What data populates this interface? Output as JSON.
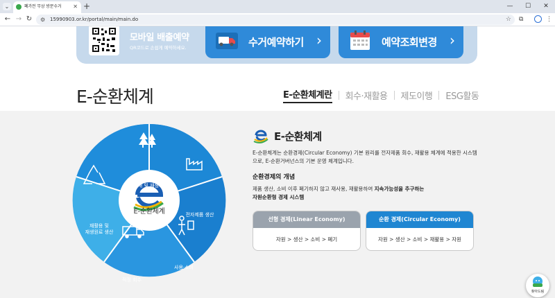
{
  "browser": {
    "tab_title": "폐가전 무상 방문수거",
    "url": "15990903.or.kr/portal/main/main.do"
  },
  "quick_bar": {
    "qr_title": "모바일 배출예약",
    "qr_subtitle": "QR코드로 손쉽게 예약하세요.",
    "buttons": [
      {
        "label": "수거예약하기",
        "icon": "truck-icon"
      },
      {
        "label": "예약조회변경",
        "icon": "calendar-icon"
      }
    ]
  },
  "section": {
    "title": "E-순환체계",
    "tabs": [
      {
        "label": "E-순환체계란",
        "active": true
      },
      {
        "label": "회수·재활용",
        "active": false
      },
      {
        "label": "제도이행",
        "active": false
      },
      {
        "label": "ESG활동",
        "active": false
      }
    ]
  },
  "wheel": {
    "center_label": "E-순환체계",
    "segments": [
      {
        "label": "원자재 및 재생 원료",
        "icon": "forest-icon"
      },
      {
        "label": "전자제품 생산",
        "icon": "factory-icon"
      },
      {
        "label": "사용·소비",
        "icon": "person-icon"
      },
      {
        "label": "적정 회수",
        "icon": "truck-icon"
      },
      {
        "label": "재활용 및\n재생원료 생산",
        "icon": "recycle-icon"
      }
    ]
  },
  "info": {
    "title": "E-순환체계",
    "description": "E-순환체계는 순환경제(Circular Economy) 기본 원리를 전자제품 회수, 재활용 체계에 적용한 시스템으로, E-순환거버넌스의 기본 운영 체계입니다.",
    "concept_title": "순환경제의 개념",
    "concept_desc_plain": "제품 생산, 소비 이후 폐기하지 않고 재사용, 재활용하여 ",
    "concept_desc_bold1": "지속가능성을 추구하는",
    "concept_desc_bold2": "자원순환형 경제 시스템",
    "cards": [
      {
        "title": "선형 경제(Linear Economy)",
        "flow": "자원 > 생산 > 소비 > 폐기",
        "color": "#9aa3ad"
      },
      {
        "title": "순환 경제(Circular Economy)",
        "flow": "자원 > 생산 > 소비 > 재활용 > 자원",
        "color": "#1f86d2"
      }
    ]
  },
  "floating": {
    "label": "찾아드림"
  },
  "colors": {
    "primary": "#1f86d2",
    "wheel_dark": "#1a7fcf",
    "wheel_light": "#2aa3e6",
    "gray": "#9aa3ad"
  }
}
